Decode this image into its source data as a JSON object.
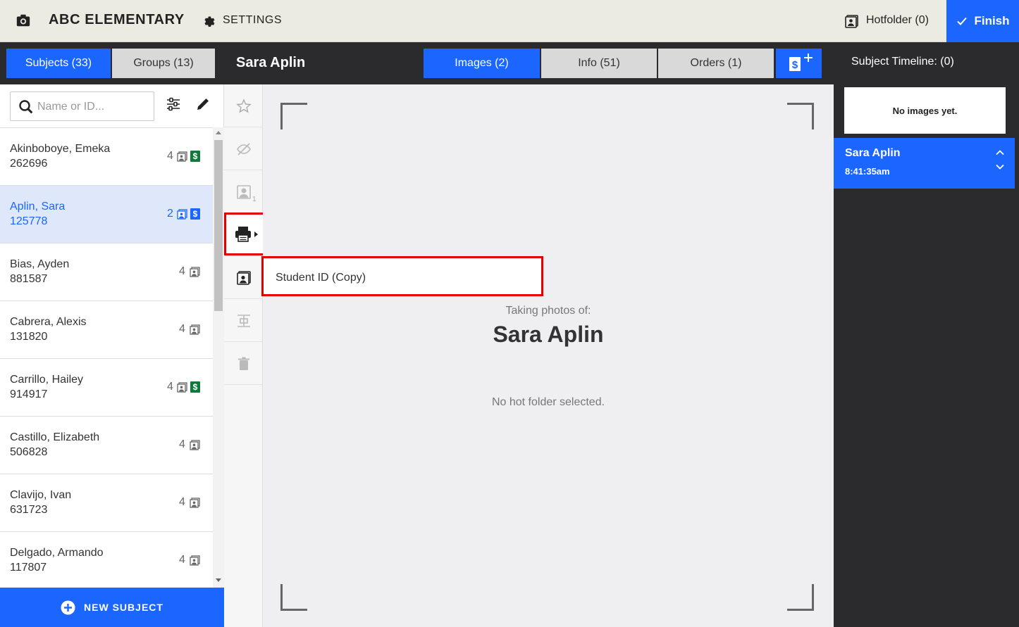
{
  "topbar": {
    "app_title": "ABC ELEMENTARY",
    "settings_label": "SETTINGS",
    "hotfolder_label": "Hotfolder (0)",
    "finish_label": "Finish"
  },
  "tabs_left": {
    "subjects": "Subjects (33)",
    "groups": "Groups (13)"
  },
  "header": {
    "subject_name": "Sara Aplin"
  },
  "tabs_main": {
    "images": "Images (2)",
    "info": "Info (51)",
    "orders": "Orders (1)"
  },
  "timeline": {
    "title": "Subject Timeline: (0)",
    "empty_text": "No images yet.",
    "entry_name": "Sara Aplin",
    "entry_time": "8:41:35am"
  },
  "search": {
    "placeholder": "Name or ID..."
  },
  "subjects": [
    {
      "name": "Akinboboye, Emeka",
      "id": "262696",
      "count": "4",
      "paid": true
    },
    {
      "name": "Aplin, Sara",
      "id": "125778",
      "count": "2",
      "paid": true,
      "selected": true
    },
    {
      "name": "Bias, Ayden",
      "id": "881587",
      "count": "4",
      "paid": false
    },
    {
      "name": "Cabrera, Alexis",
      "id": "131820",
      "count": "4",
      "paid": false
    },
    {
      "name": "Carrillo, Hailey",
      "id": "914917",
      "count": "4",
      "paid": true
    },
    {
      "name": "Castillo, Elizabeth",
      "id": "506828",
      "count": "4",
      "paid": false
    },
    {
      "name": "Clavijo, Ivan",
      "id": "631723",
      "count": "4",
      "paid": false
    },
    {
      "name": "Delgado, Armando",
      "id": "117807",
      "count": "4",
      "paid": false
    }
  ],
  "new_subject_label": "NEW SUBJECT",
  "tool_badge": "1",
  "print_menu": {
    "item": "Student ID (Copy)"
  },
  "main": {
    "taking_label": "Taking photos of:",
    "subject_name": "Sara Aplin",
    "status": "No hot folder selected."
  },
  "colors": {
    "accent": "#1a66ff",
    "paid": "#0f7a3c",
    "highlight": "#e30000",
    "topbar": "#ecebe2",
    "dark": "#2b2b2d"
  }
}
